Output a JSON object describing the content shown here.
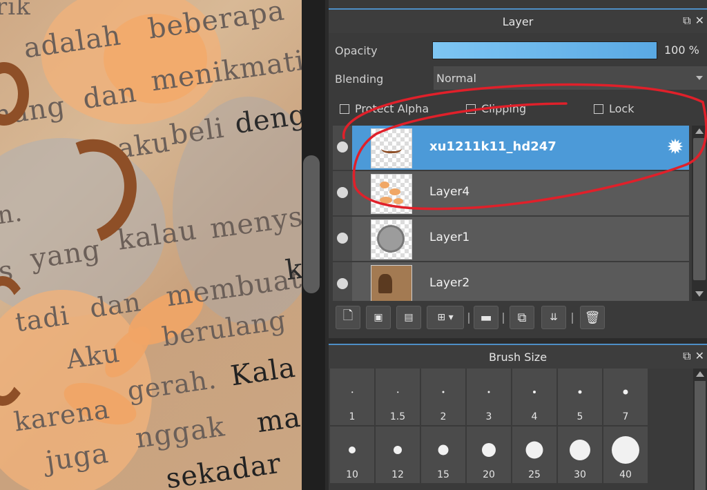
{
  "canvas": {
    "words": [
      "rik",
      "adalah",
      "beberapa",
      "hang",
      "dan",
      "menikmati",
      "aku",
      "beli",
      "deng",
      "n.",
      "s",
      "yang",
      "kalau",
      "menys",
      "membuat",
      "k",
      "tadi",
      "dan",
      "berulang",
      "Aku",
      "gerah.",
      "Kala",
      "karena",
      "nggak",
      "ma",
      "juga",
      "sekadar"
    ]
  },
  "layer_panel": {
    "title": "Layer",
    "opacity_label": "Opacity",
    "opacity_value": "100 %",
    "opacity_fraction": 1.0,
    "blending_label": "Blending",
    "blending_value": "Normal",
    "checkboxes": [
      {
        "label": "Protect Alpha",
        "checked": false
      },
      {
        "label": "Clipping",
        "checked": false
      },
      {
        "label": "Lock",
        "checked": false
      }
    ],
    "layers": [
      {
        "name": "xu1211k11_hd247",
        "selected": true
      },
      {
        "name": "Layer4",
        "selected": false
      },
      {
        "name": "Layer1",
        "selected": false
      },
      {
        "name": "Layer2",
        "selected": false
      }
    ],
    "toolbar_icons": [
      "new-layer-icon",
      "new-halftone-layer-icon",
      "new-1bit-layer-icon",
      "add-layer-menu-icon",
      "folder-icon",
      "duplicate-layer-icon",
      "merge-layer-icon",
      "delete-layer-icon"
    ]
  },
  "brush_panel": {
    "title": "Brush Size",
    "sizes": [
      "1",
      "1.5",
      "2",
      "3",
      "4",
      "5",
      "7",
      "10",
      "12",
      "15",
      "20",
      "25",
      "30",
      "40"
    ]
  },
  "colors": {
    "accent": "#4c9ad8",
    "annotation": "#e0202a",
    "deco_brown": "#8e4f27"
  }
}
